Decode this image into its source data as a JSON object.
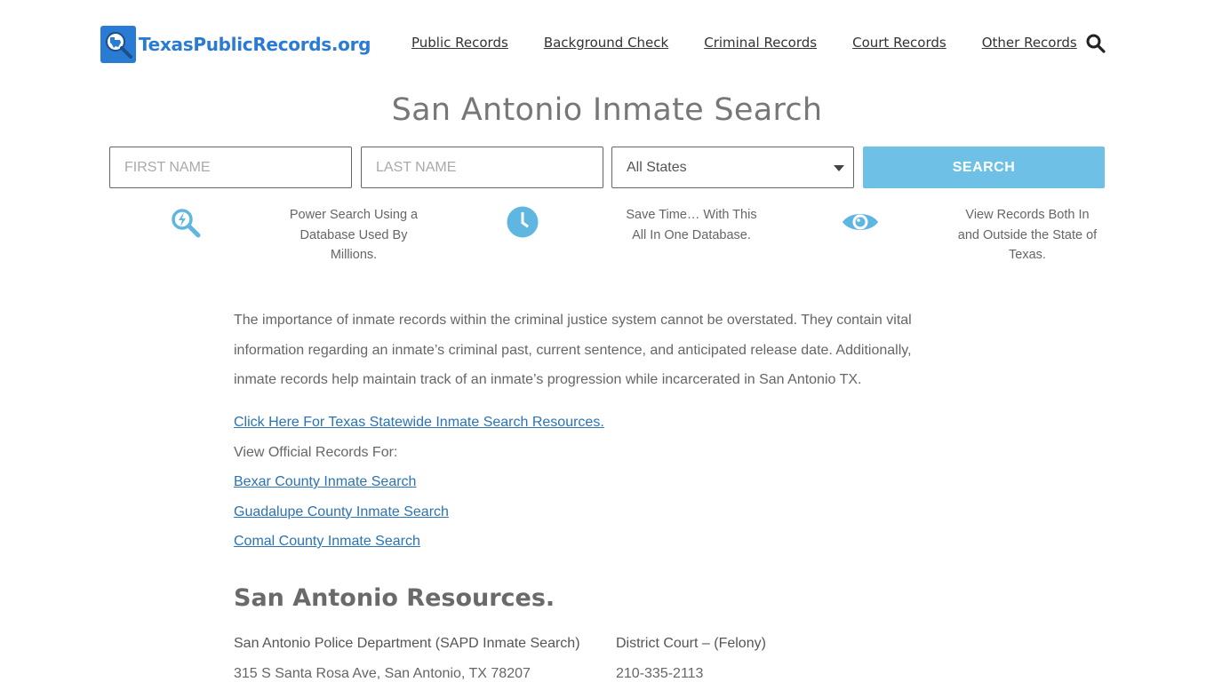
{
  "header": {
    "logo_text": "TexasPublicRecords.org",
    "nav": [
      {
        "label": "Public Records"
      },
      {
        "label": "Background Check"
      },
      {
        "label": "Criminal Records"
      },
      {
        "label": "Court Records"
      },
      {
        "label": "Other Records"
      }
    ]
  },
  "page_title": "San Antonio Inmate Search",
  "search_form": {
    "first_name_placeholder": "FIRST NAME",
    "last_name_placeholder": "LAST NAME",
    "state_selected": "All States",
    "search_label": "SEARCH"
  },
  "features": [
    {
      "icon": "power-search-icon",
      "text": "Power Search Using a Database Used By Millions."
    },
    {
      "icon": "clock-icon",
      "text": "Save Time… With This All In One Database."
    },
    {
      "icon": "eye-icon",
      "text": "View Records Both In and Outside the State of Texas."
    }
  ],
  "content": {
    "intro": "The importance of inmate records within the criminal justice system cannot be overstated. They contain vital information regarding an inmate’s criminal past, current sentence, and anticipated release date. Additionally, inmate records help maintain track of an inmate’s progression while incarcerated in San Antonio TX.",
    "statewide_link": "Click Here For Texas Statewide Inmate Search Resources.",
    "view_label": "View Official Records For:",
    "county_links": [
      {
        "label": "Bexar County Inmate Search"
      },
      {
        "label": "Guadalupe County Inmate Search"
      },
      {
        "label": "Comal County Inmate Search"
      }
    ],
    "resources_title": "San Antonio Resources.",
    "resources": [
      {
        "name": "San Antonio Police Department (SAPD Inmate Search)",
        "detail": "315 S Santa Rosa Ave, San Antonio, TX 78207"
      },
      {
        "name": "District Court – (Felony)",
        "detail": "210-335-2113"
      }
    ]
  },
  "colors": {
    "brand_blue": "#2a7bd4",
    "search_button": "#6fc0e6",
    "icon_blue": "#5fb6e0",
    "link": "#2a73b6"
  }
}
